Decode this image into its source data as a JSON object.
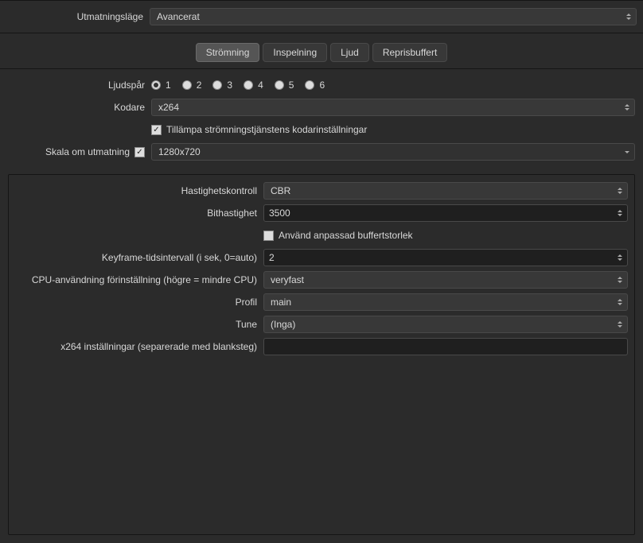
{
  "topbar": {
    "output_mode_label": "Utmatningsläge",
    "output_mode_value": "Avancerat"
  },
  "tabs": {
    "streaming": "Strömning",
    "recording": "Inspelning",
    "audio": "Ljud",
    "replay": "Reprisbuffert"
  },
  "streaming": {
    "audio_track_label": "Ljudspår",
    "audio_tracks": [
      "1",
      "2",
      "3",
      "4",
      "5",
      "6"
    ],
    "audio_track_selected": "1",
    "encoder_label": "Kodare",
    "encoder_value": "x264",
    "enforce_service_label": "Tillämpa strömningstjänstens kodarinställningar",
    "enforce_service_checked": true,
    "rescale_label": "Skala om utmatning",
    "rescale_checked": true,
    "rescale_value": "1280x720"
  },
  "encoder_settings": {
    "rate_control_label": "Hastighetskontroll",
    "rate_control_value": "CBR",
    "bitrate_label": "Bithastighet",
    "bitrate_value": "3500",
    "custom_buffer_label": "Använd anpassad buffertstorlek",
    "custom_buffer_checked": false,
    "keyframe_label": "Keyframe-tidsintervall (i sek, 0=auto)",
    "keyframe_value": "2",
    "cpu_preset_label": "CPU-användning förinställning (högre = mindre CPU)",
    "cpu_preset_value": "veryfast",
    "profile_label": "Profil",
    "profile_value": "main",
    "tune_label": "Tune",
    "tune_value": "(Inga)",
    "x264opts_label": "x264 inställningar (separerade med blanksteg)",
    "x264opts_value": ""
  }
}
